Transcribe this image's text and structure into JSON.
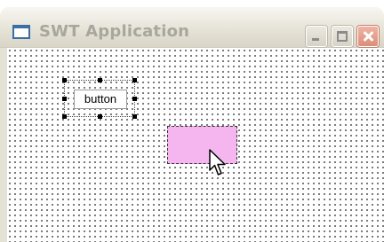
{
  "window": {
    "title": "SWT Application",
    "controls": {
      "minimize_icon": "minimize-icon",
      "maximize_icon": "maximize-icon",
      "close_icon": "close-icon"
    }
  },
  "editor": {
    "grid": "dotted",
    "selected_widget": {
      "type": "button",
      "label": "button"
    },
    "drop_feedback": {
      "color": "#f5b5ee"
    },
    "cursor_icon": "arrow-cursor-icon"
  },
  "colors": {
    "title_text": "#a8a79f",
    "close_button": "#d98f7a",
    "drop_feedback": "#f5b5ee"
  }
}
